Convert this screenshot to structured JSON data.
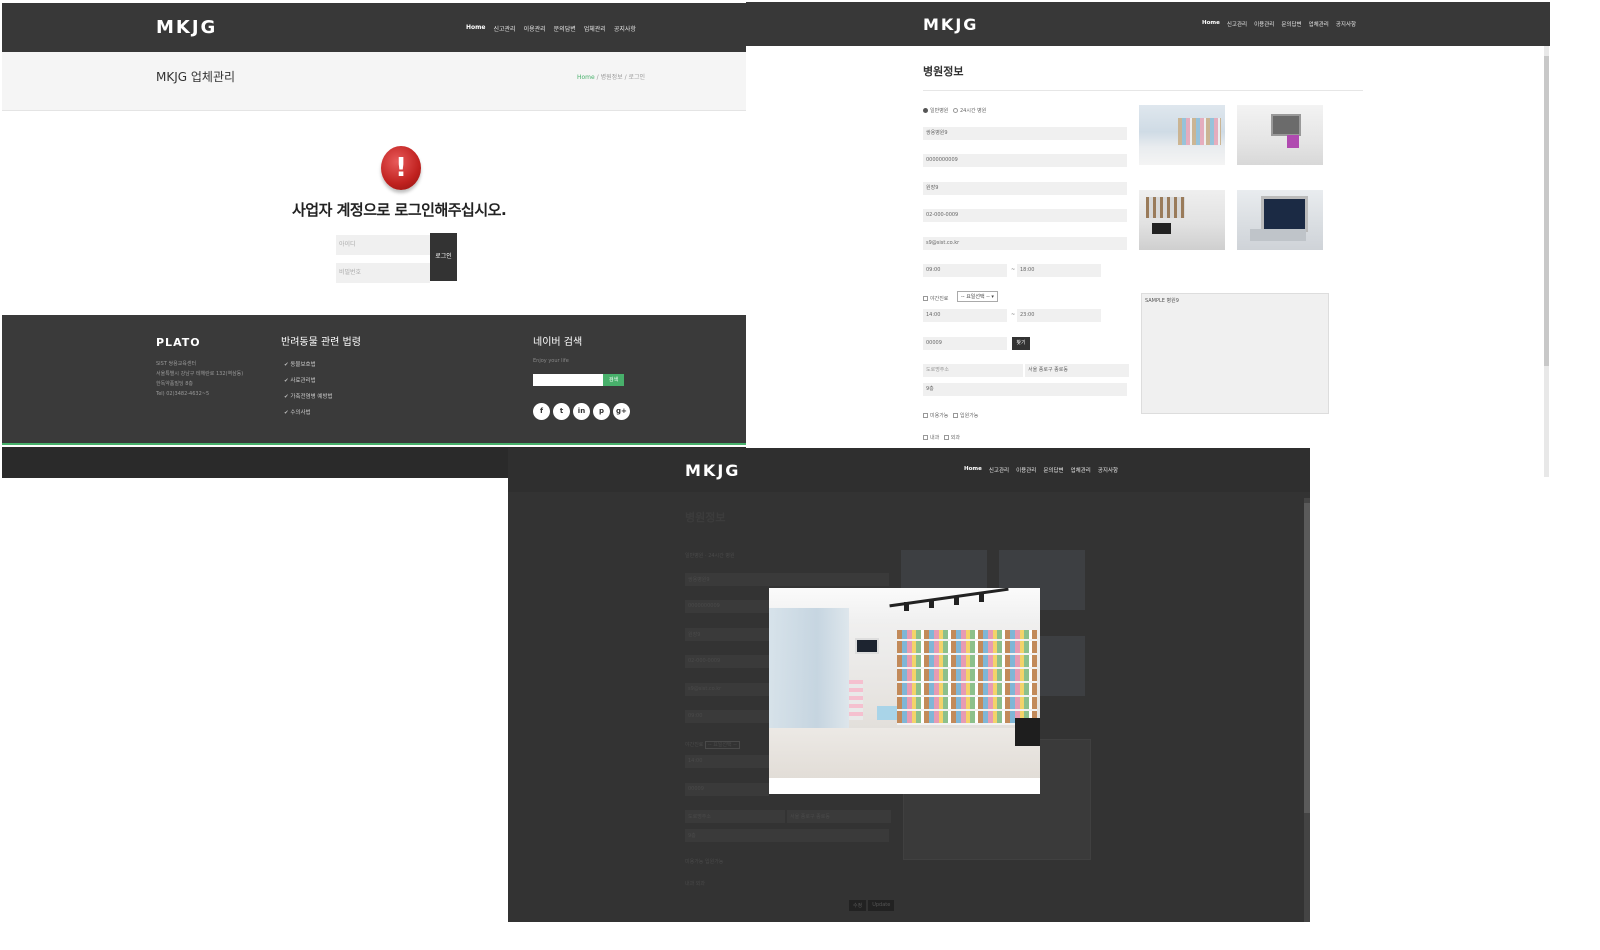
{
  "login_page": {
    "logo": "MKJG",
    "menu": [
      "Home",
      "신고관리",
      "이용관리",
      "문의답변",
      "업체관리",
      "공지사항"
    ],
    "page_title": "MKJG 업체관리",
    "breadcrumb": [
      "Home",
      "병원정보",
      "로그인"
    ],
    "alert_symbol": "!",
    "message": "사업자 계정으로 로그인해주십시오.",
    "id_placeholder": "아이디",
    "pw_placeholder": "비밀번호",
    "login_button": "로그인",
    "footer": {
      "brand": "PLATO",
      "address_lines": [
        "SIST 쌍용교육센터",
        "서울특별시 강남구 테헤란로 132(역삼동)",
        "한독약품빌딩 8층",
        "Tel) 02)3482-4632~5"
      ],
      "law_title": "반려동물 관련 법령",
      "law_items": [
        "동물보호법",
        "사료관리법",
        "가축전염병 예방법",
        "수의사법"
      ],
      "search_title": "네이버 검색",
      "search_tagline": "Enjoy your life",
      "search_button": "검색",
      "social_icons": [
        "f",
        "t",
        "in",
        "p",
        "g+"
      ]
    }
  },
  "hospital_page": {
    "logo": "MKJG",
    "menu": [
      "Home",
      "신고관리",
      "이용관리",
      "문의답변",
      "업체관리",
      "공지사항"
    ],
    "title": "병원정보",
    "type_options": [
      "일반병원",
      "24시간 병원"
    ],
    "fields": {
      "name": "쌍용병원9",
      "biz_no": "0000000009",
      "owner": "원장9",
      "phone": "02-000-0009",
      "email": "s9@sist.co.kr",
      "open_time": "09:00",
      "close_time": "18:00",
      "night_label": "야간진료",
      "day_select": "-- 요일선택 --",
      "night_start": "14:00",
      "night_end": "23:00",
      "zipcode": "00009",
      "find_button": "찾기",
      "road_address_label": "도로명주소",
      "road_address": "서울 종로구 종로동",
      "detail_address": "9층",
      "option_checks": [
        "미용가능",
        "입원가능"
      ],
      "dept_checks": [
        "내과",
        "외과"
      ],
      "description": "SAMPLE 병원9"
    },
    "time_separator": "~",
    "photos": [
      "pet-store-photo",
      "clinic-room-photo",
      "office-photo",
      "medical-machine-photo"
    ]
  },
  "modal_page": {
    "logo": "MKJG",
    "menu": [
      "Home",
      "신고관리",
      "이용관리",
      "문의답변",
      "업체관리",
      "공지사항"
    ],
    "title": "병원정보",
    "type_options": [
      "일반병원",
      "24시간 병원"
    ],
    "ghost_fields": [
      "쌍용병원9",
      "0000000009",
      "원장9",
      "02-000-0009",
      "s9@sist.co.kr",
      "09:00",
      "14:00",
      "00009",
      "도로명주소",
      "9층"
    ],
    "ghost_road_address": "서울 종로구 종로동",
    "ghost_checks": [
      "미용가능",
      "입원가능"
    ],
    "ghost_depts": [
      "내과",
      "외과"
    ],
    "night_label": "야간진료",
    "day_select": "-- 요일선택 --",
    "modal_image": "pet-store-interior-photo",
    "bottom_buttons": [
      "수정",
      "Update"
    ]
  }
}
